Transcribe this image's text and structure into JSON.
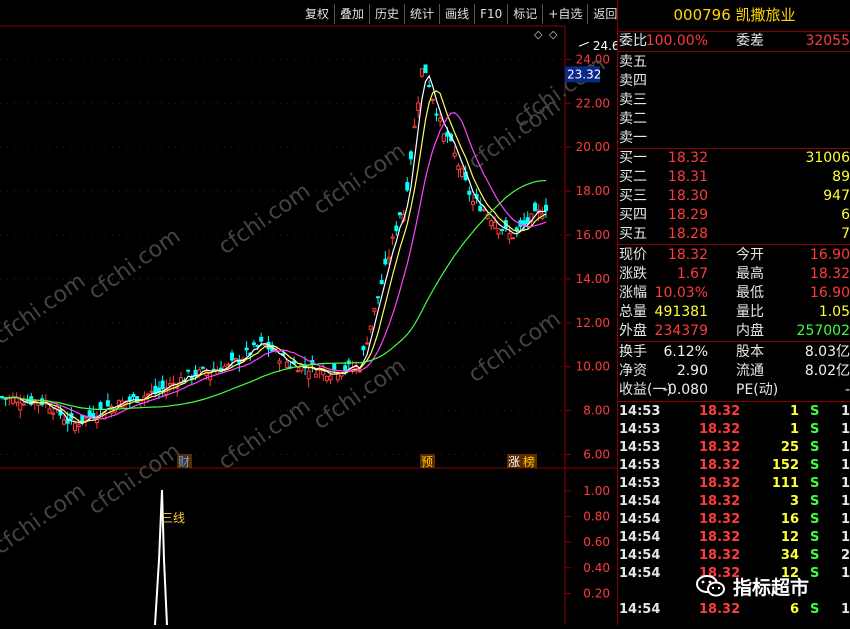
{
  "toolbar": {
    "buttons": [
      "复权",
      "叠加",
      "历史",
      "统计",
      "画线",
      "F10",
      "标记",
      "+自选",
      "返回"
    ]
  },
  "price_axis": {
    "ticks": [
      "24.00",
      "22.00",
      "20.00",
      "18.00",
      "16.00",
      "14.00",
      "12.00",
      "10.00",
      "8.00",
      "6.00"
    ],
    "current_value": "23.32"
  },
  "chart_labels": {
    "max_value": "24.60",
    "event_labels": [
      "财",
      "预",
      "涨",
      "榜"
    ],
    "indicator_line_label": "三线"
  },
  "indicator_axis": {
    "ticks": [
      "1.00",
      "0.80",
      "0.60",
      "0.40",
      "0.20"
    ]
  },
  "watermark": "cfchi.com",
  "quote": {
    "title": "000796 凯撒旅业",
    "weibi_label": "委比",
    "weibi_value": "100.00%",
    "weicha_label": "委差",
    "weicha_value": "32055",
    "sell": [
      {
        "label": "卖五",
        "price": "",
        "vol": ""
      },
      {
        "label": "卖四",
        "price": "",
        "vol": ""
      },
      {
        "label": "卖三",
        "price": "",
        "vol": ""
      },
      {
        "label": "卖二",
        "price": "",
        "vol": ""
      },
      {
        "label": "卖一",
        "price": "",
        "vol": ""
      }
    ],
    "buy": [
      {
        "label": "买一",
        "price": "18.32",
        "vol": "31006"
      },
      {
        "label": "买二",
        "price": "18.31",
        "vol": "89"
      },
      {
        "label": "买三",
        "price": "18.30",
        "vol": "947"
      },
      {
        "label": "买四",
        "price": "18.29",
        "vol": "6"
      },
      {
        "label": "买五",
        "price": "18.28",
        "vol": "7"
      }
    ],
    "stats": [
      {
        "l1": "现价",
        "v1": "18.32",
        "l2": "今开",
        "v2": "16.90"
      },
      {
        "l1": "涨跌",
        "v1": "1.67",
        "l2": "最高",
        "v2": "18.32"
      },
      {
        "l1": "涨幅",
        "v1": "10.03%",
        "l2": "最低",
        "v2": "16.90"
      },
      {
        "l1": "总量",
        "v1": "491381",
        "l2": "量比",
        "v2": "1.05"
      },
      {
        "l1": "外盘",
        "v1": "234379",
        "l2": "内盘",
        "v2": "257002"
      }
    ],
    "info": [
      {
        "l1": "换手",
        "v1": "6.12%",
        "l2": "股本",
        "v2": "8.03亿"
      },
      {
        "l1": "净资",
        "v1": "2.90",
        "l2": "流通",
        "v2": "8.02亿"
      },
      {
        "l1": "收益(一)",
        "v1": "-0.080",
        "l2": "PE(动)",
        "v2": "-"
      }
    ]
  },
  "ticks": [
    {
      "time": "14:53",
      "price": "18.32",
      "vol": "1",
      "side": "S",
      "extra": "1"
    },
    {
      "time": "14:53",
      "price": "18.32",
      "vol": "1",
      "side": "S",
      "extra": "1"
    },
    {
      "time": "14:53",
      "price": "18.32",
      "vol": "25",
      "side": "S",
      "extra": "1"
    },
    {
      "time": "14:53",
      "price": "18.32",
      "vol": "152",
      "side": "S",
      "extra": "1"
    },
    {
      "time": "14:53",
      "price": "18.32",
      "vol": "111",
      "side": "S",
      "extra": "1"
    },
    {
      "time": "14:54",
      "price": "18.32",
      "vol": "3",
      "side": "S",
      "extra": "1"
    },
    {
      "time": "14:54",
      "price": "18.32",
      "vol": "16",
      "side": "S",
      "extra": "1"
    },
    {
      "time": "14:54",
      "price": "18.32",
      "vol": "12",
      "side": "S",
      "extra": "1"
    },
    {
      "time": "14:54",
      "price": "18.32",
      "vol": "34",
      "side": "S",
      "extra": "2"
    },
    {
      "time": "14:54",
      "price": "18.32",
      "vol": "12",
      "side": "S",
      "extra": "1"
    },
    {
      "time": "14:54",
      "price": "18.32",
      "vol": "6",
      "side": "S",
      "extra": "1"
    }
  ],
  "wechat_label": "指标超市",
  "colors": {
    "up": "#ff3b3b",
    "down": "#00ffff",
    "ma1": "#ffffff",
    "ma2": "#ffff55",
    "ma3": "#ff44ff",
    "ma4": "#44ff44",
    "frame": "#8a0000"
  }
}
